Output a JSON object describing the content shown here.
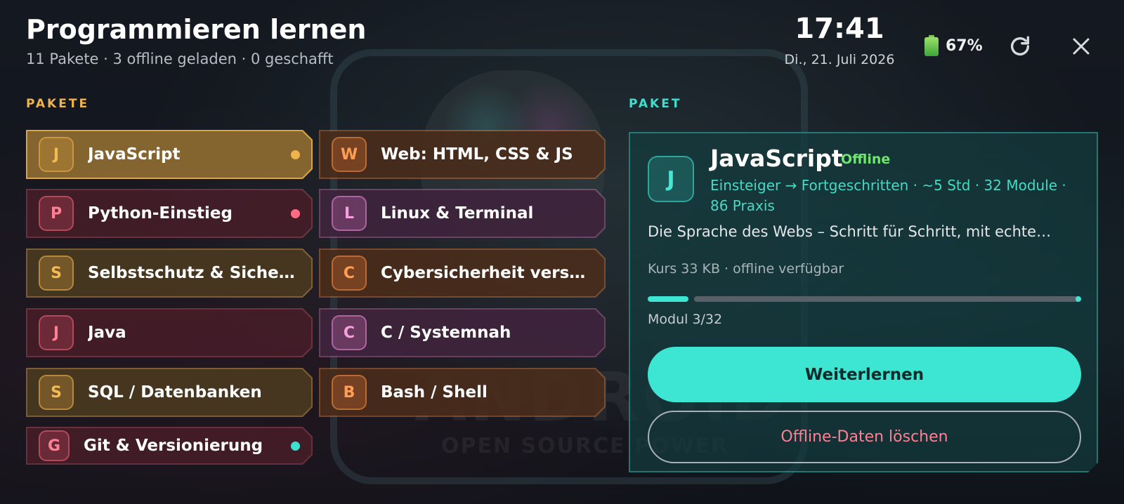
{
  "header": {
    "title": "Programmieren lernen",
    "subtitle": "11 Pakete · 3 offline geladen · 0 geschafft"
  },
  "status": {
    "time": "17:41",
    "date": "Di., 21. Juli 2026",
    "battery": "67%",
    "refresh_icon": "refresh-icon",
    "close_icon": "close-icon"
  },
  "background": {
    "word": "ANDROID",
    "sub": "OPEN SOURCE POWER"
  },
  "sections": {
    "packages_label": "PAKETE",
    "detail_label": "PAKET"
  },
  "packages": [
    {
      "letter": "J",
      "name": "JavaScript",
      "tone": "yellow",
      "active": true,
      "dot": "#f0b24b"
    },
    {
      "letter": "P",
      "name": "Python-Einstieg",
      "tone": "red",
      "active": false,
      "dot": "#ff6d84"
    },
    {
      "letter": "S",
      "name": "Selbstschutz & Sicherheit",
      "tone": "yellow",
      "active": false,
      "dot": ""
    },
    {
      "letter": "J",
      "name": "Java",
      "tone": "red",
      "active": false,
      "dot": ""
    },
    {
      "letter": "S",
      "name": "SQL / Datenbanken",
      "tone": "yellow",
      "active": false,
      "dot": ""
    },
    {
      "letter": "G",
      "name": "Git & Versionierung",
      "tone": "red",
      "active": false,
      "dot": "#3de0cf"
    },
    {
      "letter": "W",
      "name": "Web: HTML, CSS & JS",
      "tone": "orange",
      "active": false,
      "dot": ""
    },
    {
      "letter": "L",
      "name": "Linux & Terminal",
      "tone": "pink",
      "active": false,
      "dot": ""
    },
    {
      "letter": "C",
      "name": "Cybersicherheit versteh…",
      "tone": "orange",
      "active": false,
      "dot": ""
    },
    {
      "letter": "C",
      "name": "C / Systemnah",
      "tone": "pink",
      "active": false,
      "dot": ""
    },
    {
      "letter": "B",
      "name": "Bash / Shell",
      "tone": "orange",
      "active": false,
      "dot": ""
    }
  ],
  "detail": {
    "letter": "J",
    "title": "JavaScript",
    "status": "Offline",
    "meta": "Einsteiger → Fortgeschritten · ~5 Std · 32 Module · 86 Praxis",
    "description": "Die Sprache des Webs – Schritt für Schritt, mit echte…",
    "size": "Kurs 33 KB · offline verfügbar",
    "progress": 0.09375,
    "module": "Modul 3/32",
    "primary_button": "Weiterlernen",
    "secondary_button": "Offline-Daten löschen"
  },
  "colors": {
    "accent_teal": "#3de6d3",
    "accent_yellow": "#f0b24b",
    "danger_pink": "#ff7f93",
    "offline_green": "#6ee56f"
  }
}
